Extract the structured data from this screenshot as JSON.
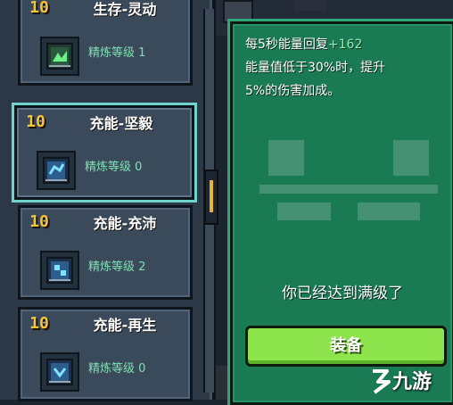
{
  "cards": [
    {
      "badge": "10",
      "title": "生存-灵动",
      "level": "精炼等级 1",
      "icon": "green-chip-icon",
      "selected": false
    },
    {
      "badge": "10",
      "title": "充能-坚毅",
      "level": "精炼等级 0",
      "icon": "blue-chip-icon",
      "selected": true
    },
    {
      "badge": "10",
      "title": "充能-充沛",
      "level": "精炼等级 2",
      "icon": "blue-chip-icon",
      "selected": false
    },
    {
      "badge": "10",
      "title": "充能-再生",
      "level": "精炼等级 0",
      "icon": "blue-chip-icon",
      "selected": false
    }
  ],
  "info": {
    "line1_prefix": "每5秒能量回复",
    "line1_plus": "+162",
    "line2": "能量值低于30%时，提升",
    "line3": "5%的伤害加成。",
    "maxed": "你已经达到满级了",
    "equip_label": "装备"
  },
  "watermark": {
    "text": "九游"
  },
  "colors": {
    "accent_green": "#1a7a54",
    "button_green": "#8ee44c",
    "badge_gold": "#f4c53a",
    "selection_cyan": "#6fd4c9",
    "level_text": "#7ee0b2"
  }
}
